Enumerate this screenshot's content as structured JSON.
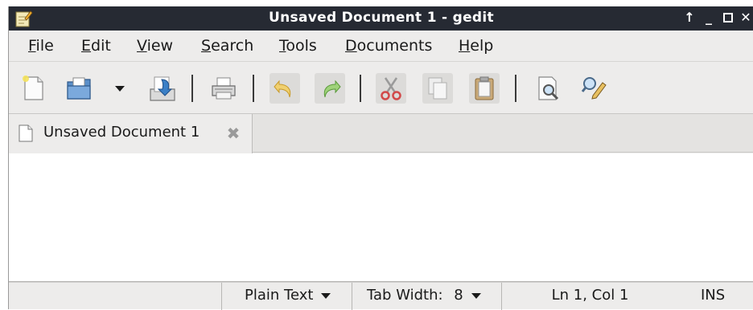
{
  "window": {
    "title": "Unsaved Document 1 - gedit",
    "app_icon": "gedit-notepad-icon",
    "controls": [
      "raise-icon",
      "minimize-icon",
      "maximize-icon",
      "close-icon"
    ]
  },
  "menubar": {
    "items": [
      {
        "mnemonic": "F",
        "rest": "ile"
      },
      {
        "mnemonic": "E",
        "rest": "dit"
      },
      {
        "mnemonic": "V",
        "rest": "iew"
      },
      {
        "mnemonic": "S",
        "rest": "earch"
      },
      {
        "mnemonic": "T",
        "rest": "ools"
      },
      {
        "mnemonic": "D",
        "rest": "ocuments"
      },
      {
        "mnemonic": "H",
        "rest": "elp"
      }
    ]
  },
  "toolbar": {
    "buttons": [
      {
        "icon": "new-document-icon",
        "enabled": true
      },
      {
        "icon": "open-folder-icon",
        "enabled": true
      },
      {
        "icon": "open-recent-dropdown-icon",
        "enabled": true
      },
      {
        "icon": "save-icon",
        "enabled": true
      },
      {
        "icon": "print-icon",
        "enabled": true
      },
      {
        "icon": "undo-icon",
        "enabled": false
      },
      {
        "icon": "redo-icon",
        "enabled": false
      },
      {
        "icon": "cut-icon",
        "enabled": false
      },
      {
        "icon": "copy-icon",
        "enabled": false
      },
      {
        "icon": "paste-icon",
        "enabled": false
      },
      {
        "icon": "find-icon",
        "enabled": true
      },
      {
        "icon": "find-replace-icon",
        "enabled": true
      }
    ]
  },
  "tabs": [
    {
      "label": "Unsaved Document 1",
      "icon": "text-document-icon",
      "close_icon": "tab-close-icon"
    }
  ],
  "editor": {
    "content": ""
  },
  "statusbar": {
    "language": "Plain Text",
    "tab_width_label": "Tab Width:",
    "tab_width_value": "8",
    "cursor_position": "Ln 1, Col 1",
    "insert_mode": "INS"
  }
}
